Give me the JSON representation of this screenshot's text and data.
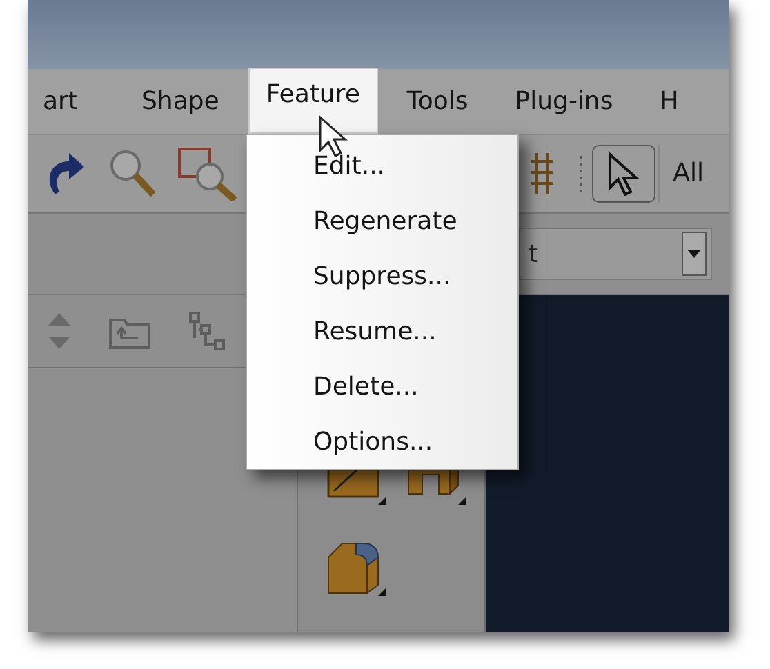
{
  "menu_bar": [
    {
      "label": "art",
      "selected": false
    },
    {
      "label": "Shape",
      "selected": false
    },
    {
      "label": "Feature",
      "selected": true
    },
    {
      "label": "Tools",
      "selected": false
    },
    {
      "label": "Plug-ins",
      "selected": false
    },
    {
      "label": "H",
      "selected": false
    }
  ],
  "toolbar": {
    "selection_filter": "All"
  },
  "combo": {
    "value": "t"
  },
  "dropdown_menu": [
    "Edit...",
    "Regenerate",
    "Suppress...",
    "Resume...",
    "Delete...",
    "Options..."
  ]
}
